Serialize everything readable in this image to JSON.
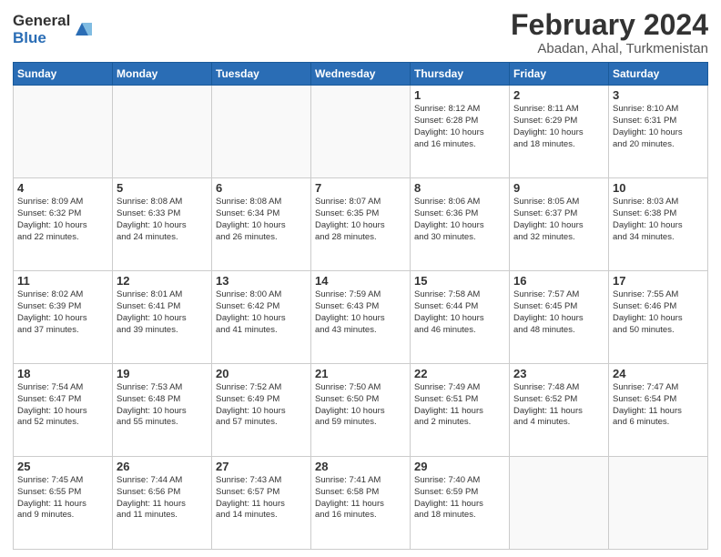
{
  "header": {
    "logo_general": "General",
    "logo_blue": "Blue",
    "title": "February 2024",
    "subtitle": "Abadan, Ahal, Turkmenistan"
  },
  "weekdays": [
    "Sunday",
    "Monday",
    "Tuesday",
    "Wednesday",
    "Thursday",
    "Friday",
    "Saturday"
  ],
  "weeks": [
    [
      {
        "day": "",
        "info": ""
      },
      {
        "day": "",
        "info": ""
      },
      {
        "day": "",
        "info": ""
      },
      {
        "day": "",
        "info": ""
      },
      {
        "day": "1",
        "info": "Sunrise: 8:12 AM\nSunset: 6:28 PM\nDaylight: 10 hours\nand 16 minutes."
      },
      {
        "day": "2",
        "info": "Sunrise: 8:11 AM\nSunset: 6:29 PM\nDaylight: 10 hours\nand 18 minutes."
      },
      {
        "day": "3",
        "info": "Sunrise: 8:10 AM\nSunset: 6:31 PM\nDaylight: 10 hours\nand 20 minutes."
      }
    ],
    [
      {
        "day": "4",
        "info": "Sunrise: 8:09 AM\nSunset: 6:32 PM\nDaylight: 10 hours\nand 22 minutes."
      },
      {
        "day": "5",
        "info": "Sunrise: 8:08 AM\nSunset: 6:33 PM\nDaylight: 10 hours\nand 24 minutes."
      },
      {
        "day": "6",
        "info": "Sunrise: 8:08 AM\nSunset: 6:34 PM\nDaylight: 10 hours\nand 26 minutes."
      },
      {
        "day": "7",
        "info": "Sunrise: 8:07 AM\nSunset: 6:35 PM\nDaylight: 10 hours\nand 28 minutes."
      },
      {
        "day": "8",
        "info": "Sunrise: 8:06 AM\nSunset: 6:36 PM\nDaylight: 10 hours\nand 30 minutes."
      },
      {
        "day": "9",
        "info": "Sunrise: 8:05 AM\nSunset: 6:37 PM\nDaylight: 10 hours\nand 32 minutes."
      },
      {
        "day": "10",
        "info": "Sunrise: 8:03 AM\nSunset: 6:38 PM\nDaylight: 10 hours\nand 34 minutes."
      }
    ],
    [
      {
        "day": "11",
        "info": "Sunrise: 8:02 AM\nSunset: 6:39 PM\nDaylight: 10 hours\nand 37 minutes."
      },
      {
        "day": "12",
        "info": "Sunrise: 8:01 AM\nSunset: 6:41 PM\nDaylight: 10 hours\nand 39 minutes."
      },
      {
        "day": "13",
        "info": "Sunrise: 8:00 AM\nSunset: 6:42 PM\nDaylight: 10 hours\nand 41 minutes."
      },
      {
        "day": "14",
        "info": "Sunrise: 7:59 AM\nSunset: 6:43 PM\nDaylight: 10 hours\nand 43 minutes."
      },
      {
        "day": "15",
        "info": "Sunrise: 7:58 AM\nSunset: 6:44 PM\nDaylight: 10 hours\nand 46 minutes."
      },
      {
        "day": "16",
        "info": "Sunrise: 7:57 AM\nSunset: 6:45 PM\nDaylight: 10 hours\nand 48 minutes."
      },
      {
        "day": "17",
        "info": "Sunrise: 7:55 AM\nSunset: 6:46 PM\nDaylight: 10 hours\nand 50 minutes."
      }
    ],
    [
      {
        "day": "18",
        "info": "Sunrise: 7:54 AM\nSunset: 6:47 PM\nDaylight: 10 hours\nand 52 minutes."
      },
      {
        "day": "19",
        "info": "Sunrise: 7:53 AM\nSunset: 6:48 PM\nDaylight: 10 hours\nand 55 minutes."
      },
      {
        "day": "20",
        "info": "Sunrise: 7:52 AM\nSunset: 6:49 PM\nDaylight: 10 hours\nand 57 minutes."
      },
      {
        "day": "21",
        "info": "Sunrise: 7:50 AM\nSunset: 6:50 PM\nDaylight: 10 hours\nand 59 minutes."
      },
      {
        "day": "22",
        "info": "Sunrise: 7:49 AM\nSunset: 6:51 PM\nDaylight: 11 hours\nand 2 minutes."
      },
      {
        "day": "23",
        "info": "Sunrise: 7:48 AM\nSunset: 6:52 PM\nDaylight: 11 hours\nand 4 minutes."
      },
      {
        "day": "24",
        "info": "Sunrise: 7:47 AM\nSunset: 6:54 PM\nDaylight: 11 hours\nand 6 minutes."
      }
    ],
    [
      {
        "day": "25",
        "info": "Sunrise: 7:45 AM\nSunset: 6:55 PM\nDaylight: 11 hours\nand 9 minutes."
      },
      {
        "day": "26",
        "info": "Sunrise: 7:44 AM\nSunset: 6:56 PM\nDaylight: 11 hours\nand 11 minutes."
      },
      {
        "day": "27",
        "info": "Sunrise: 7:43 AM\nSunset: 6:57 PM\nDaylight: 11 hours\nand 14 minutes."
      },
      {
        "day": "28",
        "info": "Sunrise: 7:41 AM\nSunset: 6:58 PM\nDaylight: 11 hours\nand 16 minutes."
      },
      {
        "day": "29",
        "info": "Sunrise: 7:40 AM\nSunset: 6:59 PM\nDaylight: 11 hours\nand 18 minutes."
      },
      {
        "day": "",
        "info": ""
      },
      {
        "day": "",
        "info": ""
      }
    ]
  ]
}
